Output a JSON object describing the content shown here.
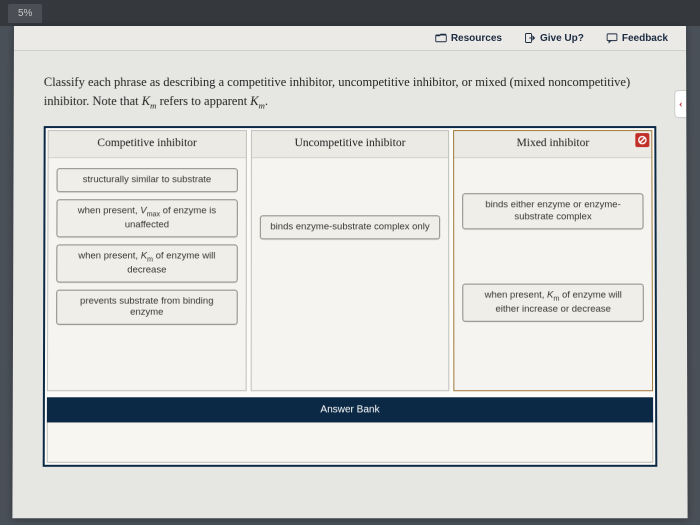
{
  "chrome": {
    "tab_pct": "5%"
  },
  "toolbar": {
    "resources": "Resources",
    "giveup": "Give Up?",
    "feedback": "Feedback"
  },
  "question": {
    "line1_a": "Classify each phrase as describing a competitive inhibitor, uncompetitive inhibitor, or mixed (mixed noncompetitive)",
    "line2_a": "inhibitor. Note that ",
    "km": "K",
    "km_sub": "m",
    "line2_b": " refers to apparent ",
    "line2_c": "."
  },
  "columns": {
    "competitive": {
      "header": "Competitive inhibitor"
    },
    "uncompetitive": {
      "header": "Uncompetitive inhibitor"
    },
    "mixed": {
      "header": "Mixed inhibitor"
    }
  },
  "chips": {
    "c1": "structurally similar to substrate",
    "c2_a": "when present, ",
    "c2_v": "V",
    "c2_vs": "max",
    "c2_b": " of enzyme is unaffected",
    "c3_a": "when present, ",
    "c3_k": "K",
    "c3_ks": "m",
    "c3_b": " of enzyme will decrease",
    "c4": "prevents substrate from binding enzyme",
    "u1": "binds enzyme-substrate complex only",
    "m1": "binds either enzyme or enzyme-substrate complex",
    "m2_a": "when present, ",
    "m2_k": "K",
    "m2_ks": "m",
    "m2_b": " of enzyme will either increase or decrease"
  },
  "answerbank": {
    "label": "Answer Bank"
  }
}
